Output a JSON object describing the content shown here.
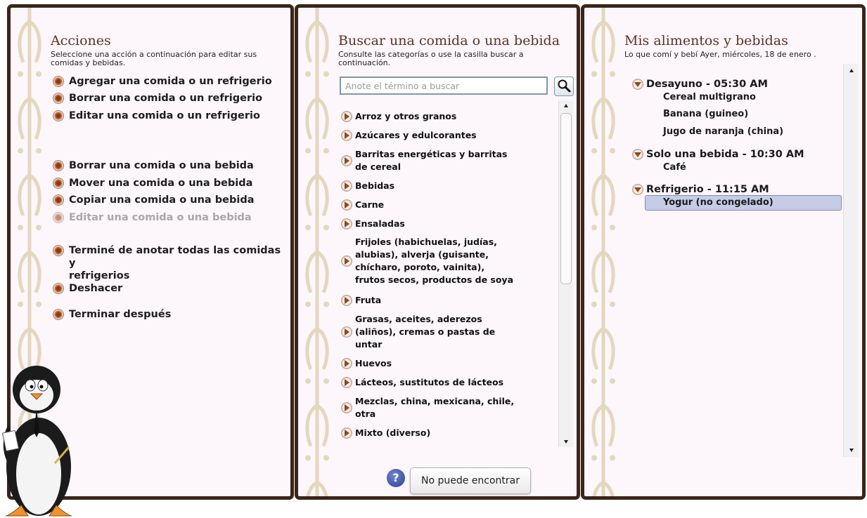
{
  "acciones": {
    "title": "Acciones",
    "subtitle_line1": "Seleccione una acción a continuación para editar sus",
    "subtitle_line2": "comidas y bebidas.",
    "items": [
      {
        "label": "Agregar una comida o un refrigerio",
        "enabled": true
      },
      {
        "label": "Borrar una comida o un refrigerio",
        "enabled": true
      },
      {
        "label": "Editar una comida o un refrigerio",
        "enabled": true
      },
      {
        "label": "Borrar una comida o una bebida",
        "enabled": true
      },
      {
        "label": "Mover una comida o una bebida",
        "enabled": true
      },
      {
        "label": "Copiar una comida o una bebida",
        "enabled": true
      },
      {
        "label": "Editar una comida o una bebida",
        "enabled": false
      },
      {
        "label_line1": "Terminé de anotar todas las comidas y",
        "label_line2": "refrigerios",
        "enabled": true
      },
      {
        "label": "Deshacer",
        "enabled": true
      },
      {
        "label": "Terminar después",
        "enabled": true
      }
    ]
  },
  "buscar": {
    "title": "Buscar una comida o una bebida",
    "subtitle_line1": "Consulte las categorías o use la casilla buscar a",
    "subtitle_line2": "continuación.",
    "search_placeholder": "Anote el término a buscar",
    "search_icon": "magnifier-icon",
    "categories": [
      {
        "lines": [
          "Arroz y otros granos"
        ]
      },
      {
        "lines": [
          "Azúcares y edulcorantes"
        ]
      },
      {
        "lines": [
          "Barritas energéticas y barritas",
          "de cereal"
        ]
      },
      {
        "lines": [
          "Bebidas"
        ]
      },
      {
        "lines": [
          "Carne"
        ]
      },
      {
        "lines": [
          "Ensaladas"
        ]
      },
      {
        "lines": [
          "Frijoles (habichuelas, judías,",
          "alubias), alverja (guisante,",
          "chícharo, poroto, vainita),",
          "frutos secos, productos de soya"
        ]
      },
      {
        "lines": [
          "Fruta"
        ]
      },
      {
        "lines": [
          "Grasas, aceites, aderezos",
          "(aliños), cremas o pastas de",
          "untar"
        ]
      },
      {
        "lines": [
          "Huevos"
        ]
      },
      {
        "lines": [
          "Lácteos, sustitutos de lácteos"
        ]
      },
      {
        "lines": [
          "Mezclas, china, mexicana, chile,",
          "otra"
        ]
      },
      {
        "lines": [
          "Mixto (diverso)"
        ]
      }
    ],
    "help_label": "?",
    "cant_find_label": "No puede encontrar"
  },
  "mis_alimentos": {
    "title": "Mis alimentos y bebidas",
    "subtitle": "Lo que comí y bebí Ayer, miércoles, 18 de enero .",
    "meals": [
      {
        "heading": "Desayuno - 05:30 AM",
        "items": [
          "Cereal multigrano",
          "Banana (guineo)",
          "Jugo de naranja (china)"
        ]
      },
      {
        "heading": "Solo una bebida - 10:30 AM",
        "items": [
          "Café"
        ]
      },
      {
        "heading": "Refrigerio - 11:15 AM",
        "items": [
          "Yogur (no congelado)"
        ],
        "selected_item": "Yogur (no congelado)"
      }
    ]
  },
  "colors": {
    "panel_border": "#3b2419",
    "panel_bg": "#fdf6fa",
    "title": "#5e3226",
    "selection": "#c6cce6"
  }
}
